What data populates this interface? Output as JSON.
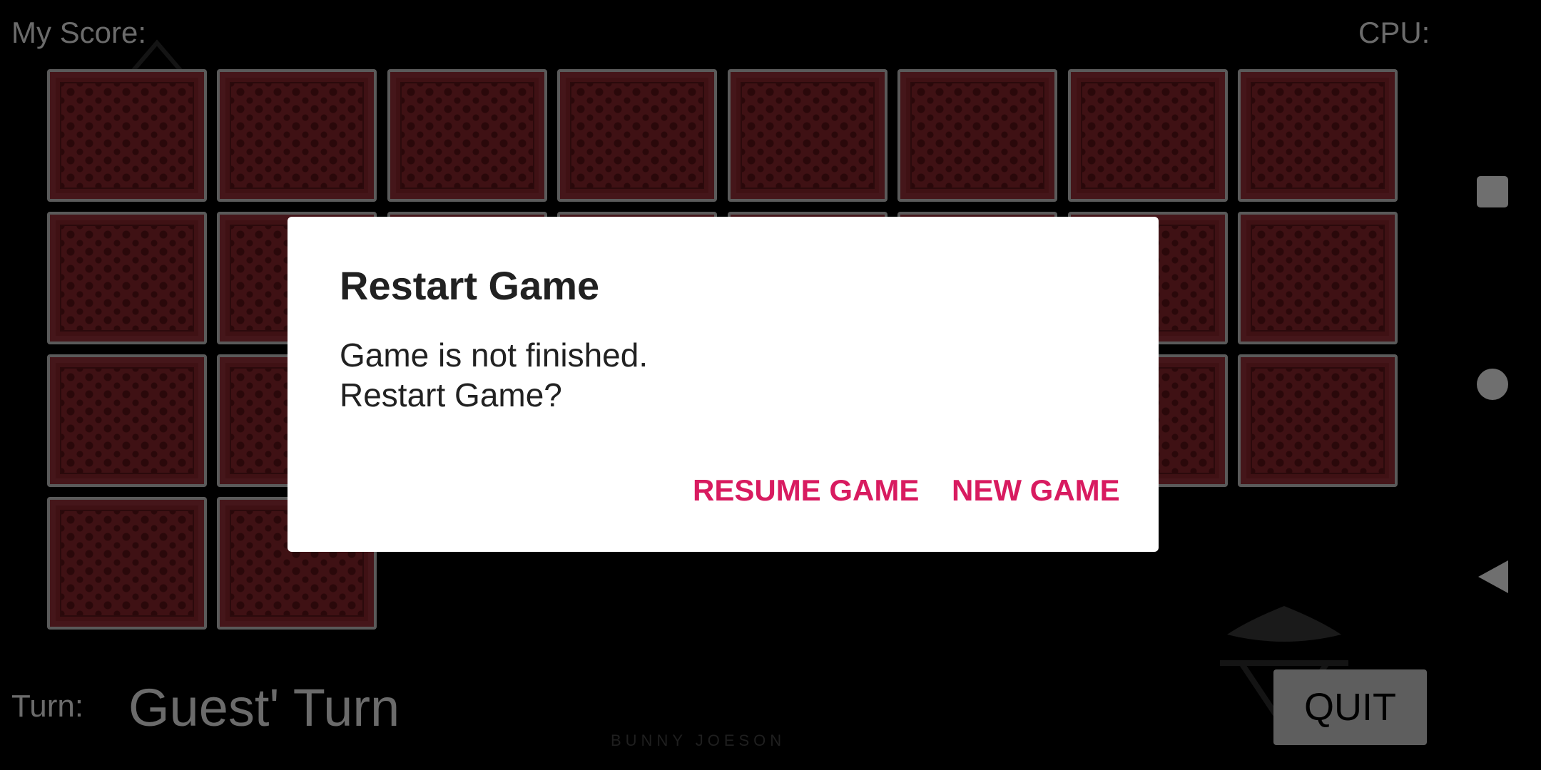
{
  "header": {
    "my_score_label": "My Score:",
    "cpu_label": "CPU:"
  },
  "board": {
    "rows": [
      8,
      8,
      8,
      2
    ],
    "card_back_color": "#3f1114"
  },
  "footer": {
    "turn_label": "Turn:",
    "turn_value": "Guest' Turn",
    "quit_label": "QUIT",
    "watermark": "BUNNY JOESON"
  },
  "dialog": {
    "title": "Restart Game",
    "message_line1": "Game is not finished.",
    "message_line2": "Restart Game?",
    "resume_label": "RESUME GAME",
    "new_game_label": "NEW GAME",
    "accent_color": "#d81b60"
  },
  "navbar": {
    "icons": [
      "recents-icon",
      "home-icon",
      "back-icon"
    ]
  }
}
